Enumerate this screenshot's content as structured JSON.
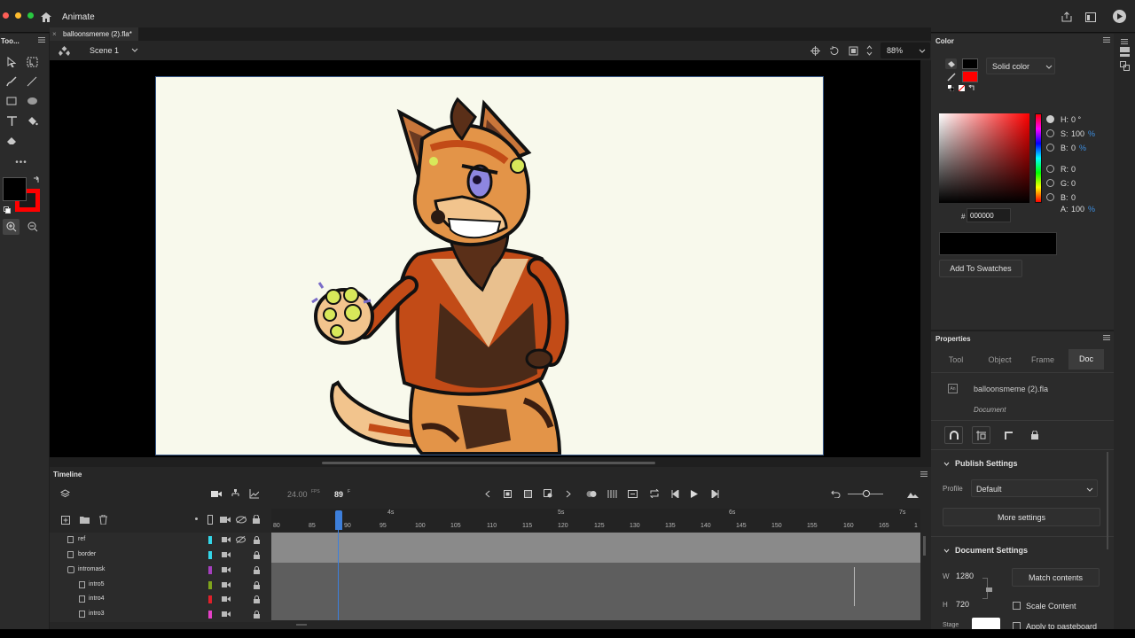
{
  "app": {
    "name": "Animate"
  },
  "document_tab": {
    "title": "balloonsmeme (2).fla*"
  },
  "tools_panel": {
    "title": "Too..."
  },
  "stage_bar": {
    "scene": "Scene 1",
    "zoom": "88%"
  },
  "color_panel": {
    "title": "Color",
    "fill_type": "Solid color",
    "h_label": "H:",
    "h_value": "0 °",
    "s_label": "S:",
    "s_value": "100",
    "s_unit": "%",
    "bh_label": "B:",
    "bh_value": "0",
    "bh_unit": "%",
    "r_label": "R:",
    "r_value": "0",
    "g_label": "G:",
    "g_value": "0",
    "b_label": "B:",
    "b_value": "0",
    "a_label": "A:",
    "a_value": "100",
    "a_unit": "%",
    "hex_label": "#",
    "hex_value": "000000",
    "add_swatch": "Add To Swatches",
    "colors": {
      "stroke": "#000000",
      "fill": "#ff0000",
      "accent": "#ff0000"
    }
  },
  "properties": {
    "title": "Properties",
    "tabs": [
      "Tool",
      "Object",
      "Frame",
      "Doc"
    ],
    "active_tab": "Doc",
    "doc_name": "balloonsmeme (2).fla",
    "doc_type": "Document",
    "publish_settings": "Publish Settings",
    "profile_label": "Profile",
    "profile_value": "Default",
    "more_settings": "More settings",
    "document_settings": "Document Settings",
    "w_label": "W",
    "w_value": "1280",
    "h_label": "H",
    "h_value": "720",
    "match_contents": "Match contents",
    "scale_content": "Scale Content",
    "stage_label": "Stage",
    "apply_pasteboard": "Apply to pasteboard"
  },
  "timeline": {
    "title": "Timeline",
    "fps": "24.00",
    "fps_unit": "FPS",
    "frame": "89",
    "frame_unit": "F",
    "ruler": [
      "80",
      "85",
      "90",
      "95",
      "100",
      "105",
      "110",
      "115",
      "120",
      "125",
      "130",
      "135",
      "140",
      "145",
      "150",
      "155",
      "160",
      "165",
      "1"
    ],
    "seconds": [
      "4s",
      "5s",
      "6s",
      "7s"
    ],
    "layers": [
      {
        "name": "ref",
        "color": "#33d6e8"
      },
      {
        "name": "border",
        "color": "#33d6e8"
      },
      {
        "name": "intromask",
        "color": "#a63fbf"
      },
      {
        "name": "intro5",
        "color": "#7fa41c"
      },
      {
        "name": "intro4",
        "color": "#e0202a"
      },
      {
        "name": "intro3",
        "color": "#e640c8"
      }
    ]
  }
}
